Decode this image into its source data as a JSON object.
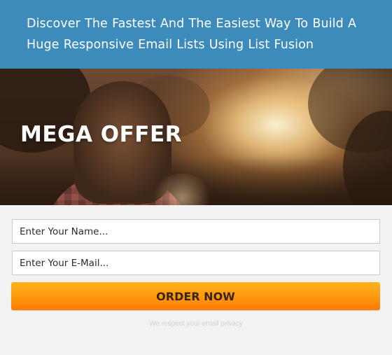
{
  "header": {
    "headline": "Discover The Fastest And The Easiest Way To Build A Huge Responsive Email Lists Using List Fusion",
    "background_color": "#3c8bbb"
  },
  "hero": {
    "title": "MEGA OFFER"
  },
  "form": {
    "name_placeholder": "Enter Your Name...",
    "email_placeholder": "Enter Your E-Mail...",
    "submit_label": "ORDER NOW",
    "button_color": "#ff9a0e",
    "privacy_text": "We respect your email privacy"
  }
}
